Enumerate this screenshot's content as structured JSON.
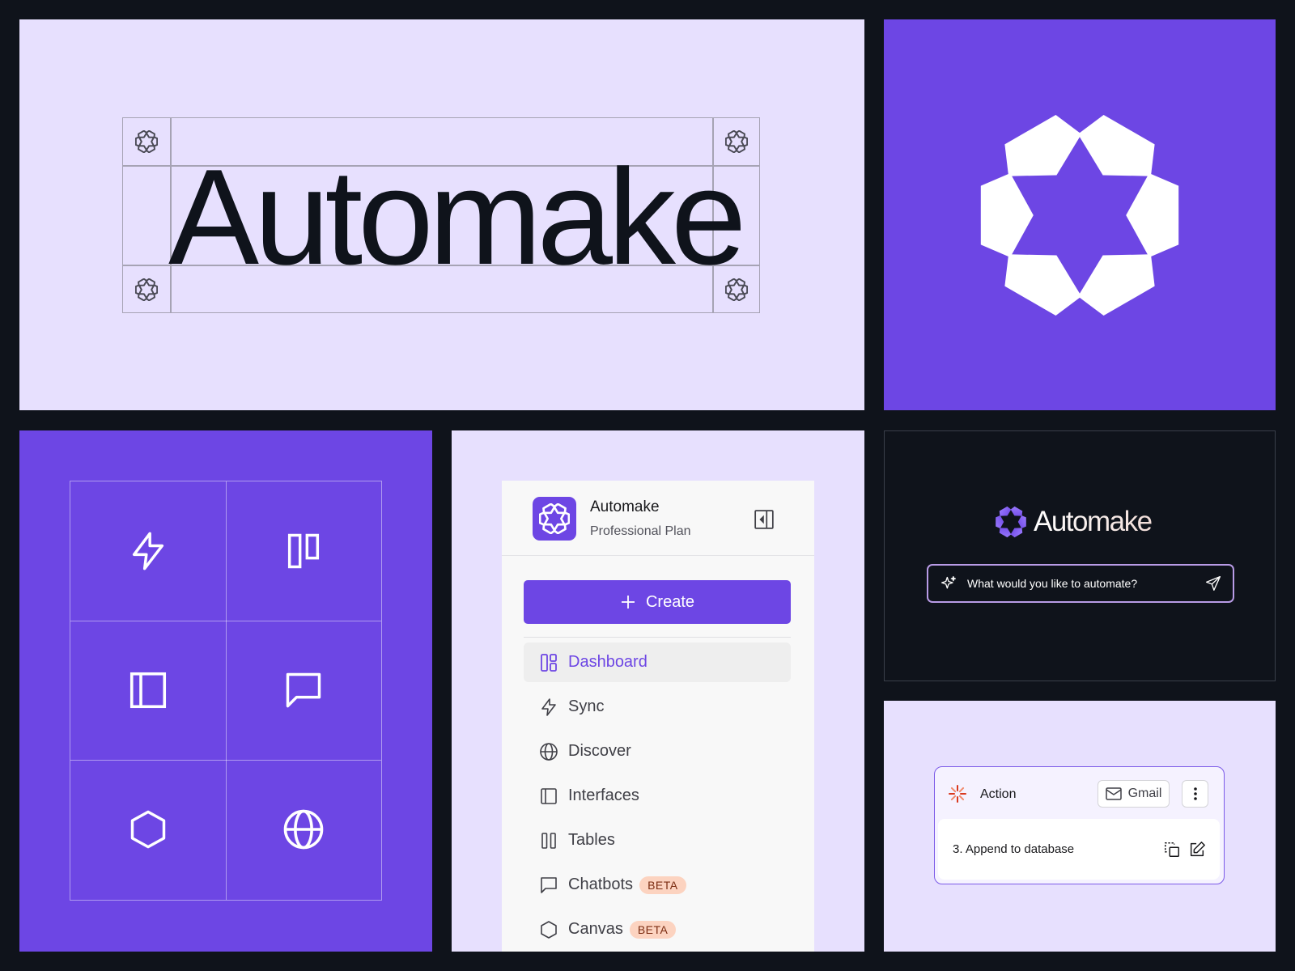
{
  "brand": {
    "name": "Automake",
    "colors": {
      "primary": "#6d46e4",
      "lavender": "#e7e0fe",
      "ink": "#0f131b",
      "beta_badge": "#fcd3c0"
    }
  },
  "wordmark_panel": {
    "text": "Automake"
  },
  "icon_grid": {
    "icons": [
      "lightning-icon",
      "columns-icon",
      "sidebar-panel-icon",
      "chat-bubble-icon",
      "hexagon-icon",
      "globe-icon"
    ]
  },
  "sidebar": {
    "workspace_name": "Automake",
    "plan": "Professional Plan",
    "create_label": "Create",
    "nav": [
      {
        "label": "Dashboard",
        "icon": "dashboard-icon",
        "active": true
      },
      {
        "label": "Sync",
        "icon": "lightning-icon"
      },
      {
        "label": "Discover",
        "icon": "globe-icon"
      },
      {
        "label": "Interfaces",
        "icon": "sidebar-panel-icon"
      },
      {
        "label": "Tables",
        "icon": "columns-icon"
      },
      {
        "label": "Chatbots",
        "icon": "chat-bubble-icon",
        "badge": "BETA"
      },
      {
        "label": "Canvas",
        "icon": "hexagon-icon",
        "badge": "BETA"
      }
    ]
  },
  "prompt": {
    "logo_text": "Automake",
    "placeholder": "What would you like to automate?"
  },
  "action_card": {
    "title": "Action",
    "integration": "Gmail",
    "step": "3. Append to database"
  }
}
